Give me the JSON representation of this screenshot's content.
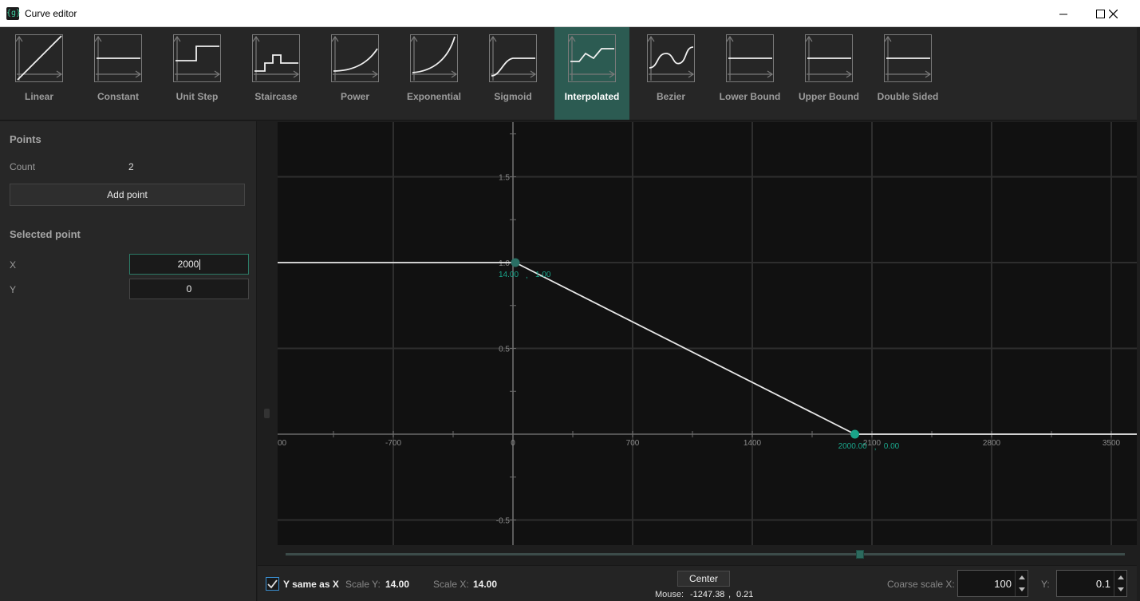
{
  "window": {
    "title": "Curve editor",
    "app_icon_text": "{g}"
  },
  "toolbar": {
    "items": [
      {
        "label": "Linear",
        "icon": "linear-curve-icon"
      },
      {
        "label": "Constant",
        "icon": "constant-curve-icon"
      },
      {
        "label": "Unit Step",
        "icon": "unit-step-curve-icon"
      },
      {
        "label": "Staircase",
        "icon": "staircase-curve-icon"
      },
      {
        "label": "Power",
        "icon": "power-curve-icon"
      },
      {
        "label": "Exponential",
        "icon": "exponential-curve-icon"
      },
      {
        "label": "Sigmoid",
        "icon": "sigmoid-curve-icon"
      },
      {
        "label": "Interpolated",
        "icon": "interpolated-curve-icon",
        "active": true
      },
      {
        "label": "Bezier",
        "icon": "bezier-curve-icon"
      },
      {
        "label": "Lower Bound",
        "icon": "lower-bound-curve-icon"
      },
      {
        "label": "Upper Bound",
        "icon": "upper-bound-curve-icon"
      },
      {
        "label": "Double Sided",
        "icon": "double-sided-curve-icon"
      }
    ]
  },
  "points_panel": {
    "title": "Points",
    "count_label": "Count",
    "count_value": "2",
    "add_button": "Add point"
  },
  "selected_point": {
    "title": "Selected point",
    "x_label": "X",
    "x_value": "2000",
    "y_label": "Y",
    "y_value": "0"
  },
  "graph": {
    "x_ticks": [
      "00",
      "-700",
      "0",
      "700",
      "1400",
      "2100",
      "2800",
      "3500"
    ],
    "y_ticks": [
      "1.5",
      "1.0",
      "0.5",
      "-0.5"
    ],
    "points": [
      {
        "x": 14.0,
        "y": 1.0,
        "label_x": "14.00",
        "sep": ",",
        "label_y": "1.00"
      },
      {
        "x": 2000.0,
        "y": 0.0,
        "label_x": "2000.00",
        "sep": ",",
        "label_y": "0.00"
      }
    ],
    "curve_color": "#e8e8e8",
    "point_color": "#1aa58a",
    "grid_color": "#2e2e2e"
  },
  "bottom": {
    "y_same_as_x_label": "Y same as X",
    "y_same_as_x_checked": true,
    "scale_y_label": "Scale Y:",
    "scale_y_value": "14.00",
    "scale_x_label": "Scale X:",
    "scale_x_value": "14.00",
    "center_button": "Center",
    "mouse_label": "Mouse:",
    "mouse_x": "-1247.38",
    "mouse_sep": ",",
    "mouse_y": "0.21",
    "coarse_x_label": "Coarse scale X:",
    "coarse_x_value": "100",
    "coarse_y_label": "Y:",
    "coarse_y_value": "0.1"
  }
}
